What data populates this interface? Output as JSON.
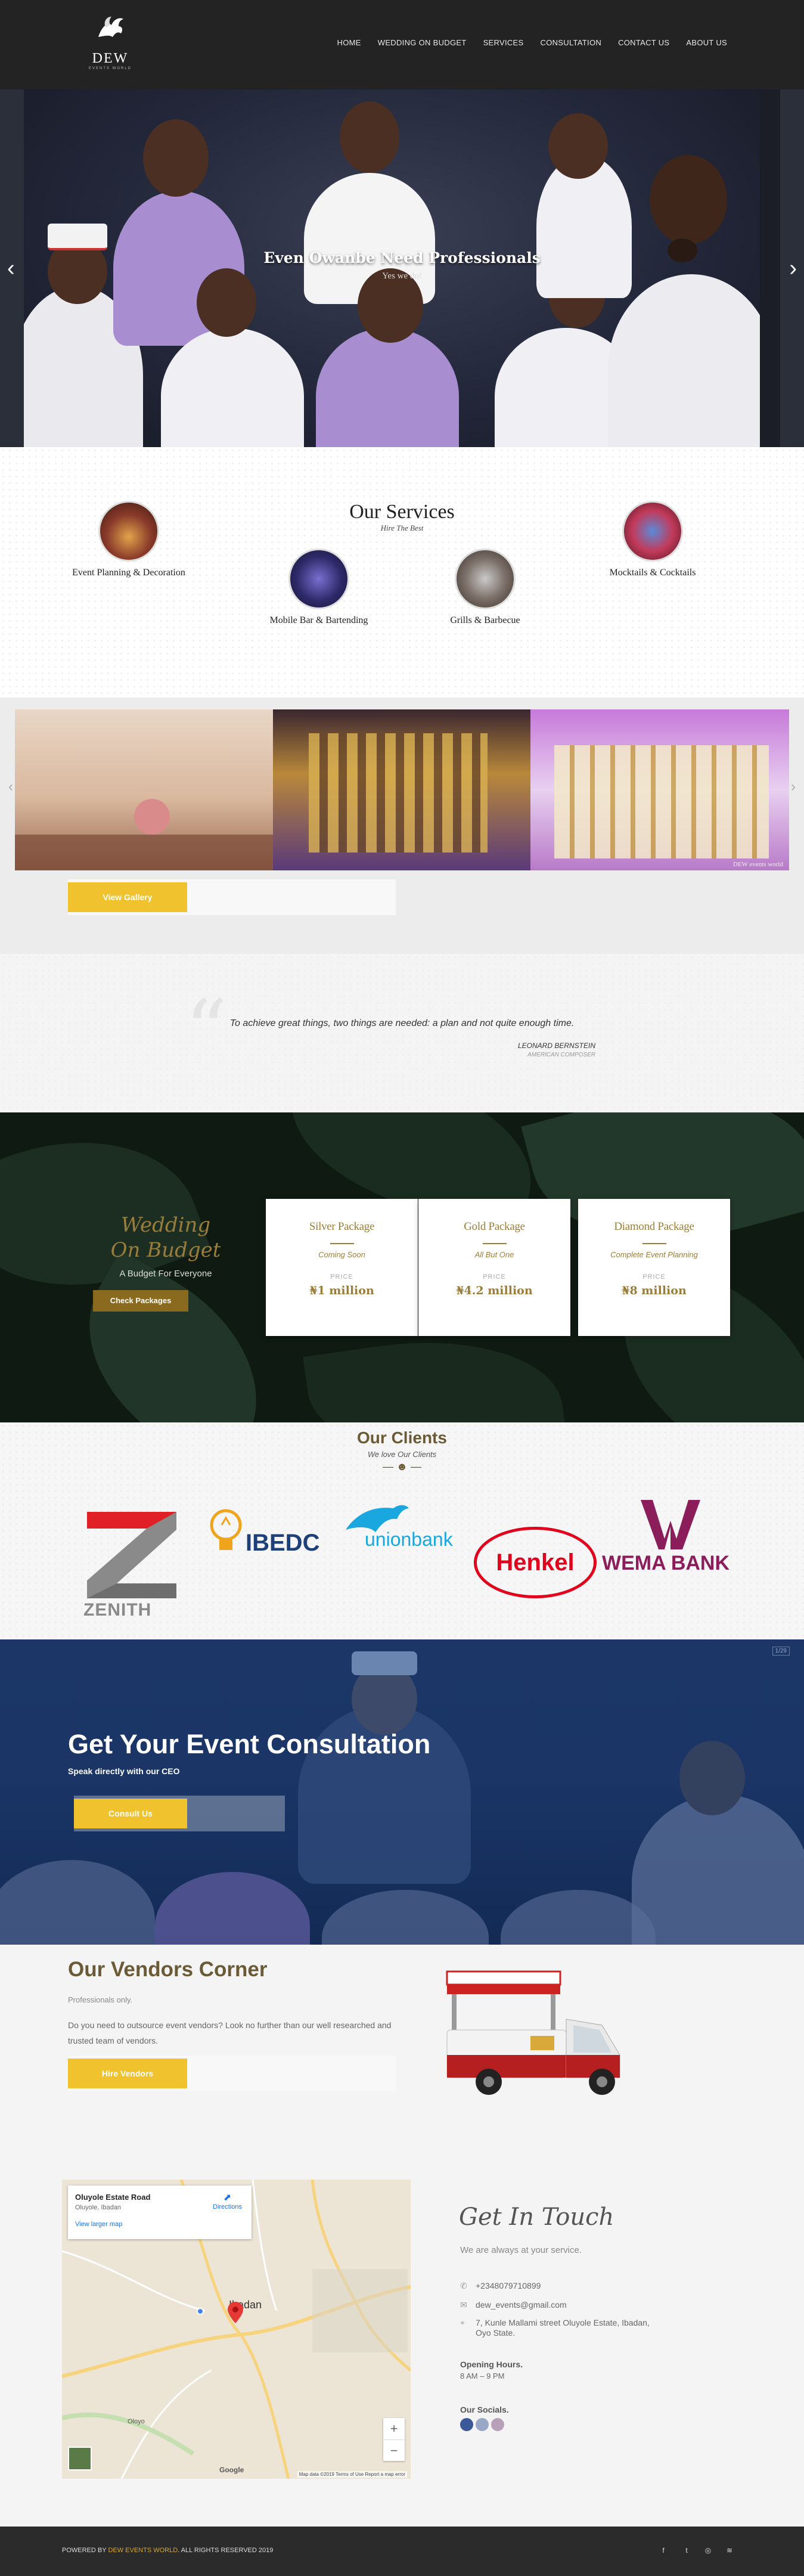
{
  "header": {
    "logo_text": "DEW",
    "logo_sub": "EVENTS WORLD",
    "nav": [
      "HOME",
      "WEDDING ON BUDGET",
      "SERVICES",
      "CONSULTATION",
      "CONTACT US",
      "ABOUT US"
    ]
  },
  "hero": {
    "title": "Even Owanbe Need Professionals",
    "subtitle": "Yes we do!"
  },
  "services": {
    "title": "Our Services",
    "subtitle": "Hire The Best",
    "items": [
      "Event Planning & Decoration",
      "Mobile Bar & Bartending",
      "Grills & Barbecue",
      "Mocktails & Cocktails"
    ]
  },
  "gallery": {
    "caption": "DEW events world",
    "button": "View Gallery"
  },
  "quote": {
    "text": "To achieve great things, two things are needed: a plan and not quite enough time.",
    "author": "LEONARD BERNSTEIN",
    "role": "AMERICAN COMPOSER"
  },
  "budget": {
    "title_line1": "Wedding",
    "title_line2": "On Budget",
    "subtitle": "A Budget For Everyone",
    "button": "Check Packages",
    "packages": [
      {
        "name": "Silver Package",
        "note": "Coming Soon",
        "label": "PRICE",
        "price": "₦1 million"
      },
      {
        "name": "Gold Package",
        "note": "All But One",
        "label": "PRICE",
        "price": "₦4.2 million"
      },
      {
        "name": "Diamond Package",
        "note": "Complete Event Planning",
        "label": "PRICE",
        "price": "₦8 million"
      }
    ]
  },
  "clients": {
    "title": "Our Clients",
    "subtitle": "We love Our Clients",
    "logos": [
      "ZENITH",
      "IBEDC",
      "unionbank",
      "Henkel",
      "WEMA BANK"
    ]
  },
  "consultation": {
    "title": "Get Your Event Consultation",
    "subtitle": "Speak directly with our CEO",
    "button": "Consult Us",
    "badge": "1/29"
  },
  "vendors": {
    "title": "Our Vendors Corner",
    "subtitle": "Professionals only.",
    "description": "Do you need to outsource event vendors? Look no further than our well researched and trusted team of vendors.",
    "button": "Hire Vendors"
  },
  "contact": {
    "map": {
      "place": "Oluyole Estate Road",
      "area": "Oluyole, Ibadan",
      "larger_map": "View larger map",
      "directions": "Directions",
      "city_label": "Ibadan",
      "town_label": "Oloyo",
      "zoom_in": "+",
      "zoom_out": "−",
      "attribution": "Map data ©2019   Terms of Use   Report a map error",
      "google": "Google"
    },
    "title": "Get In Touch",
    "subtitle": "We are always at your service.",
    "phone": "+2348079710899",
    "email": "dew_events@gmail.com",
    "address_line1": "7, Kunle Mallami street Oluyole Estate, Ibadan,",
    "address_line2": "Oyo State.",
    "hours_title": "Opening Hours.",
    "hours": "8 AM – 9 PM",
    "socials_title": "Our Socials."
  },
  "footer": {
    "prefix": "POWERED BY ",
    "brand": "DEW EVENTS WORLD",
    "suffix": ". ALL RIGHTS RESERVED 2019",
    "icons": [
      "f",
      "t",
      "◎",
      "≋"
    ]
  },
  "colors": {
    "accent_yellow": "#f0c22d",
    "gold": "#9b7d3a",
    "brown_heading": "#6b5a36",
    "consult_blue": "#1a3566",
    "header_dark": "#232323"
  }
}
